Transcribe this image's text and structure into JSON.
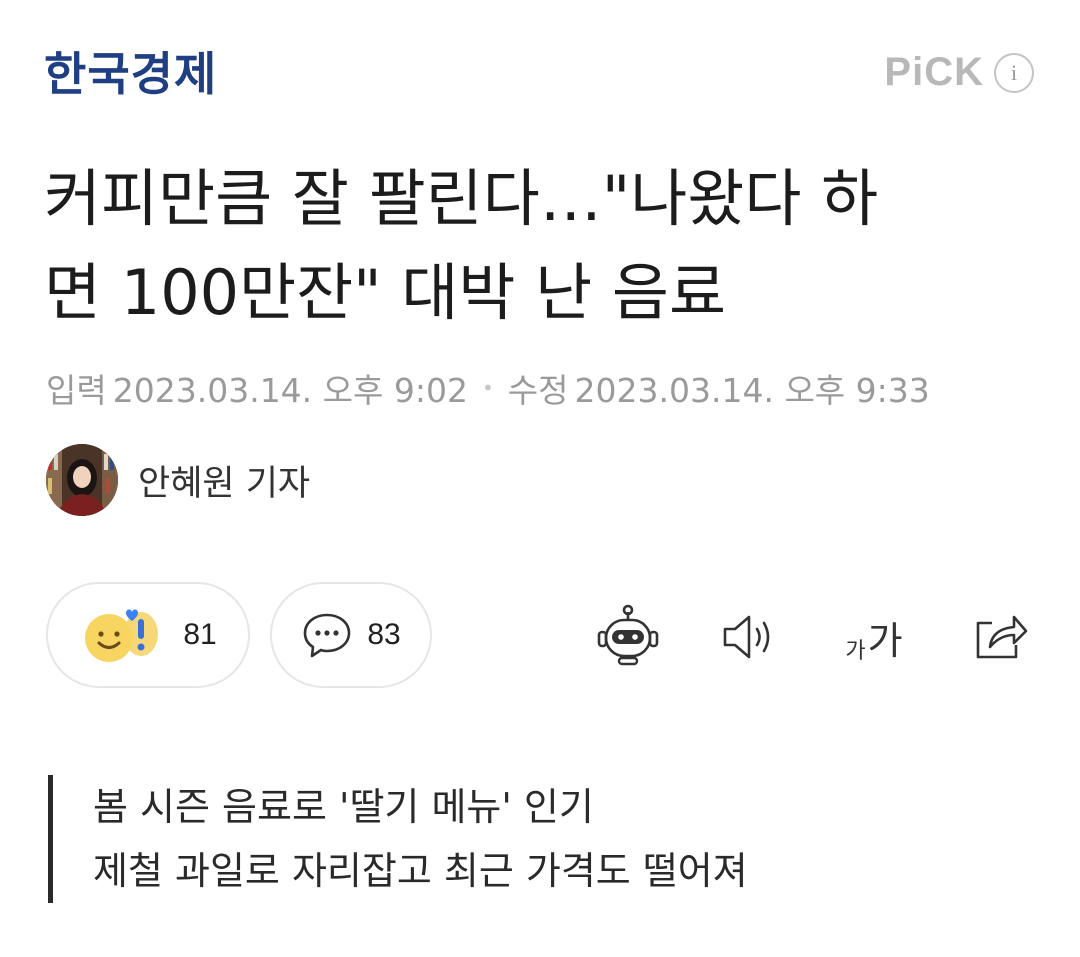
{
  "header": {
    "logo_text": "한국경제",
    "pick_label": "PiCK",
    "info_icon": "i"
  },
  "article": {
    "title_line1": "커피만큼 잘 팔린다…\"나왔다 하",
    "title_line2": "면 100만잔\" 대박 난 음료",
    "published_label": "입력",
    "published_at": "2023.03.14. 오후 9:02",
    "separator": "•",
    "modified_label": "수정",
    "modified_at": "2023.03.14. 오후 9:33",
    "author": "안혜원 기자",
    "summary": [
      "봄 시즌 음료로 '딸기 메뉴' 인기",
      "제철 과일로 자리잡고 최근 가격도 떨어져"
    ]
  },
  "actions": {
    "reaction_count": "81",
    "comment_count": "83",
    "font_size_label_small": "가",
    "font_size_label_large": "가"
  },
  "colors": {
    "logo": "#1f3f82",
    "muted": "#9a9a9a",
    "emoji_yellow": "#f4d35e",
    "emoji_blue": "#3b82f6"
  },
  "icons": [
    "info-icon",
    "smile-emoji-icon",
    "exclamation-emoji-icon",
    "heart-icon",
    "comment-icon",
    "robot-summary-icon",
    "speaker-icon",
    "font-size-icon",
    "share-icon"
  ]
}
